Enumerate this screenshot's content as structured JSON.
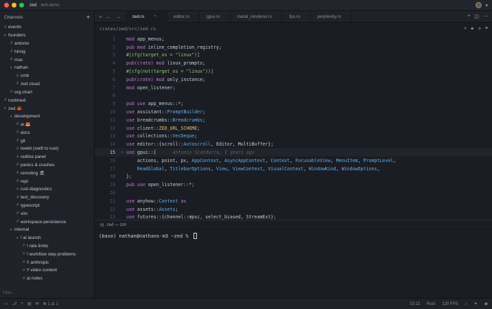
{
  "window": {
    "project": "zed",
    "branch": "tent-demo"
  },
  "sidebar": {
    "title": "Channels",
    "add_icon": "plus-icon",
    "filter_placeholder": "Filter...",
    "channels": [
      {
        "label": "events",
        "depth": 0,
        "parent": false
      },
      {
        "label": "founders",
        "depth": 0,
        "parent": true
      },
      {
        "label": "antonio",
        "depth": 1,
        "parent": false
      },
      {
        "label": "hiring",
        "depth": 1,
        "parent": false
      },
      {
        "label": "max",
        "depth": 1,
        "parent": false
      },
      {
        "label": "nathan",
        "depth": 1,
        "parent": true
      },
      {
        "label": "cmb",
        "depth": 2,
        "parent": false
      },
      {
        "label": "zed cloud",
        "depth": 2,
        "parent": false
      },
      {
        "label": "org-chart",
        "depth": 1,
        "parent": false
      },
      {
        "label": "runtimed",
        "depth": 0,
        "parent": false
      },
      {
        "label": "zed 🦀",
        "depth": 0,
        "parent": true
      },
      {
        "label": "development",
        "depth": 1,
        "parent": true
      },
      {
        "label": "ai 🦊",
        "depth": 2,
        "parent": false
      },
      {
        "label": "docs",
        "depth": 2,
        "parent": false
      },
      {
        "label": "git",
        "depth": 2,
        "parent": false
      },
      {
        "label": "livekit (swift to rust)",
        "depth": 2,
        "parent": false
      },
      {
        "label": "outline panel",
        "depth": 2,
        "parent": false
      },
      {
        "label": "panics & crashes",
        "depth": 2,
        "parent": false
      },
      {
        "label": "remoting 🏖",
        "depth": 2,
        "parent": false
      },
      {
        "label": "repl",
        "depth": 2,
        "parent": false
      },
      {
        "label": "rust-diagnostics",
        "depth": 2,
        "parent": false
      },
      {
        "label": "test_discovery",
        "depth": 2,
        "parent": false
      },
      {
        "label": "typescript",
        "depth": 2,
        "parent": false
      },
      {
        "label": "vim",
        "depth": 2,
        "parent": false
      },
      {
        "label": "workspace-persistence",
        "depth": 2,
        "parent": false
      },
      {
        "label": "internal",
        "depth": 1,
        "parent": true
      },
      {
        "label": "! ai launch",
        "depth": 2,
        "parent": true
      },
      {
        "label": "! rate limits",
        "depth": 3,
        "parent": false
      },
      {
        "label": "! workflow step problems",
        "depth": 3,
        "parent": false
      },
      {
        "label": "!! anthropic",
        "depth": 3,
        "parent": false
      },
      {
        "label": "!! video content",
        "depth": 3,
        "parent": false
      },
      {
        "label": "ai notes",
        "depth": 3,
        "parent": false
      }
    ]
  },
  "tabs": [
    {
      "label": "zed.rs",
      "active": true
    },
    {
      "label": "editor.rs",
      "active": false
    },
    {
      "label": "gpui.rs",
      "active": false
    },
    {
      "label": "metal_renderer.rs",
      "active": false
    },
    {
      "label": "fps.rs",
      "active": false
    },
    {
      "label": "perplexity.rs",
      "active": false
    }
  ],
  "breadcrumb": "crates/zed/src/zed.rs",
  "editor": {
    "current_line": 15,
    "blame": "Antonio Scandurra, 3 years ago",
    "lines": [
      {
        "n": "1",
        "tokens": [
          [
            "k",
            "mod"
          ],
          [
            "",
            "app_menus;"
          ]
        ]
      },
      {
        "n": "2",
        "tokens": [
          [
            "k",
            "pub mod"
          ],
          [
            "",
            "inline_completion_registry;"
          ]
        ]
      },
      {
        "n": "3",
        "tokens": [
          [
            "m",
            "#[cfg(target_os = \"linux\")]"
          ]
        ]
      },
      {
        "n": "4",
        "tokens": [
          [
            "k",
            "pub(crate) mod"
          ],
          [
            "",
            "linux_prompts;"
          ]
        ]
      },
      {
        "n": "5",
        "tokens": [
          [
            "m",
            "#[cfg(not(target_os = \"linux\"))]"
          ]
        ]
      },
      {
        "n": "6",
        "tokens": [
          [
            "k",
            "pub(crate) mod"
          ],
          [
            "",
            "only_instance;"
          ]
        ]
      },
      {
        "n": "7",
        "tokens": [
          [
            "k",
            "mod"
          ],
          [
            "",
            "open_listener;"
          ]
        ]
      },
      {
        "n": "8",
        "tokens": []
      },
      {
        "n": "9",
        "tokens": [
          [
            "k",
            "pub use"
          ],
          [
            "",
            "app_menus::*;"
          ]
        ]
      },
      {
        "n": "10",
        "tokens": [
          [
            "k",
            "use"
          ],
          [
            "",
            "assistant::"
          ],
          [
            "t",
            "PromptBuilder"
          ],
          [
            "",
            ";"
          ]
        ]
      },
      {
        "n": "11",
        "tokens": [
          [
            "k",
            "use"
          ],
          [
            "",
            "breadcrumbs::"
          ],
          [
            "t",
            "Breadcrumbs"
          ],
          [
            "",
            ";"
          ]
        ]
      },
      {
        "n": "12",
        "tokens": [
          [
            "k",
            "use"
          ],
          [
            "",
            "client::"
          ],
          [
            "c",
            "ZED_URL_SCHEME"
          ],
          [
            "",
            ";"
          ]
        ]
      },
      {
        "n": "13",
        "tokens": [
          [
            "k",
            "use"
          ],
          [
            "",
            "collections::"
          ],
          [
            "t",
            "VecDeque"
          ],
          [
            "",
            ";"
          ]
        ]
      },
      {
        "n": "14",
        "tokens": [
          [
            "k",
            "use"
          ],
          [
            "",
            "editor::{scroll::"
          ],
          [
            "t",
            "Autoscroll"
          ],
          [
            "",
            ", Editor, MultiBuffer};"
          ]
        ]
      },
      {
        "n": "15",
        "tokens": [
          [
            "k",
            "use"
          ],
          [
            "",
            "gpui::{"
          ]
        ],
        "blame": true
      },
      {
        "n": "16",
        "tokens": [
          [
            "",
            "    actions, point, px, "
          ],
          [
            "t",
            "AppContext"
          ],
          [
            "",
            ", "
          ],
          [
            "t",
            "AsyncAppContext"
          ],
          [
            "",
            ", "
          ],
          [
            "t",
            "Context"
          ],
          [
            "",
            ", "
          ],
          [
            "t",
            "FocusableView"
          ],
          [
            "",
            ", "
          ],
          [
            "t",
            "MenuItem"
          ],
          [
            "",
            ", "
          ],
          [
            "t",
            "PromptLevel"
          ],
          [
            "",
            ","
          ]
        ]
      },
      {
        "n": "17",
        "tokens": [
          [
            "",
            "    "
          ],
          [
            "t",
            "ReadGlobal"
          ],
          [
            "",
            ", "
          ],
          [
            "t",
            "TitlebarOptions"
          ],
          [
            "",
            ", "
          ],
          [
            "t",
            "View"
          ],
          [
            "",
            ", "
          ],
          [
            "t",
            "ViewContext"
          ],
          [
            "",
            ", "
          ],
          [
            "t",
            "VisualContext"
          ],
          [
            "",
            ", "
          ],
          [
            "t",
            "WindowKind"
          ],
          [
            "",
            ", "
          ],
          [
            "t",
            "WindowOptions"
          ],
          [
            "",
            ","
          ]
        ]
      },
      {
        "n": "18",
        "tokens": [
          [
            "",
            "};"
          ]
        ]
      },
      {
        "n": "19",
        "tokens": [
          [
            "k",
            "pub use"
          ],
          [
            "",
            "open_listener::*;"
          ]
        ]
      },
      {
        "n": "20",
        "tokens": []
      },
      {
        "n": "21",
        "tokens": [
          [
            "k",
            "use"
          ],
          [
            "",
            "anyhow::"
          ],
          [
            "t",
            "Context"
          ],
          [
            "k",
            " as"
          ],
          [
            "",
            "",
            " _;"
          ]
        ]
      },
      {
        "n": "22",
        "tokens": [
          [
            "k",
            "use"
          ],
          [
            "",
            "assets::"
          ],
          [
            "t",
            "Assets"
          ],
          [
            "",
            ";"
          ]
        ]
      },
      {
        "n": "23",
        "tokens": [
          [
            "k",
            "use"
          ],
          [
            "",
            "futures::{channel::mpsc, select_biased, StreamExt};"
          ]
        ]
      }
    ]
  },
  "terminal": {
    "tab_label": "zed — zsh",
    "prompt": "(base) nathan@nathans-m3 ~zed % "
  },
  "status": {
    "errors": "1",
    "warnings": "1",
    "position": "15:12",
    "language": "Rust",
    "fps": "120 FPS"
  }
}
